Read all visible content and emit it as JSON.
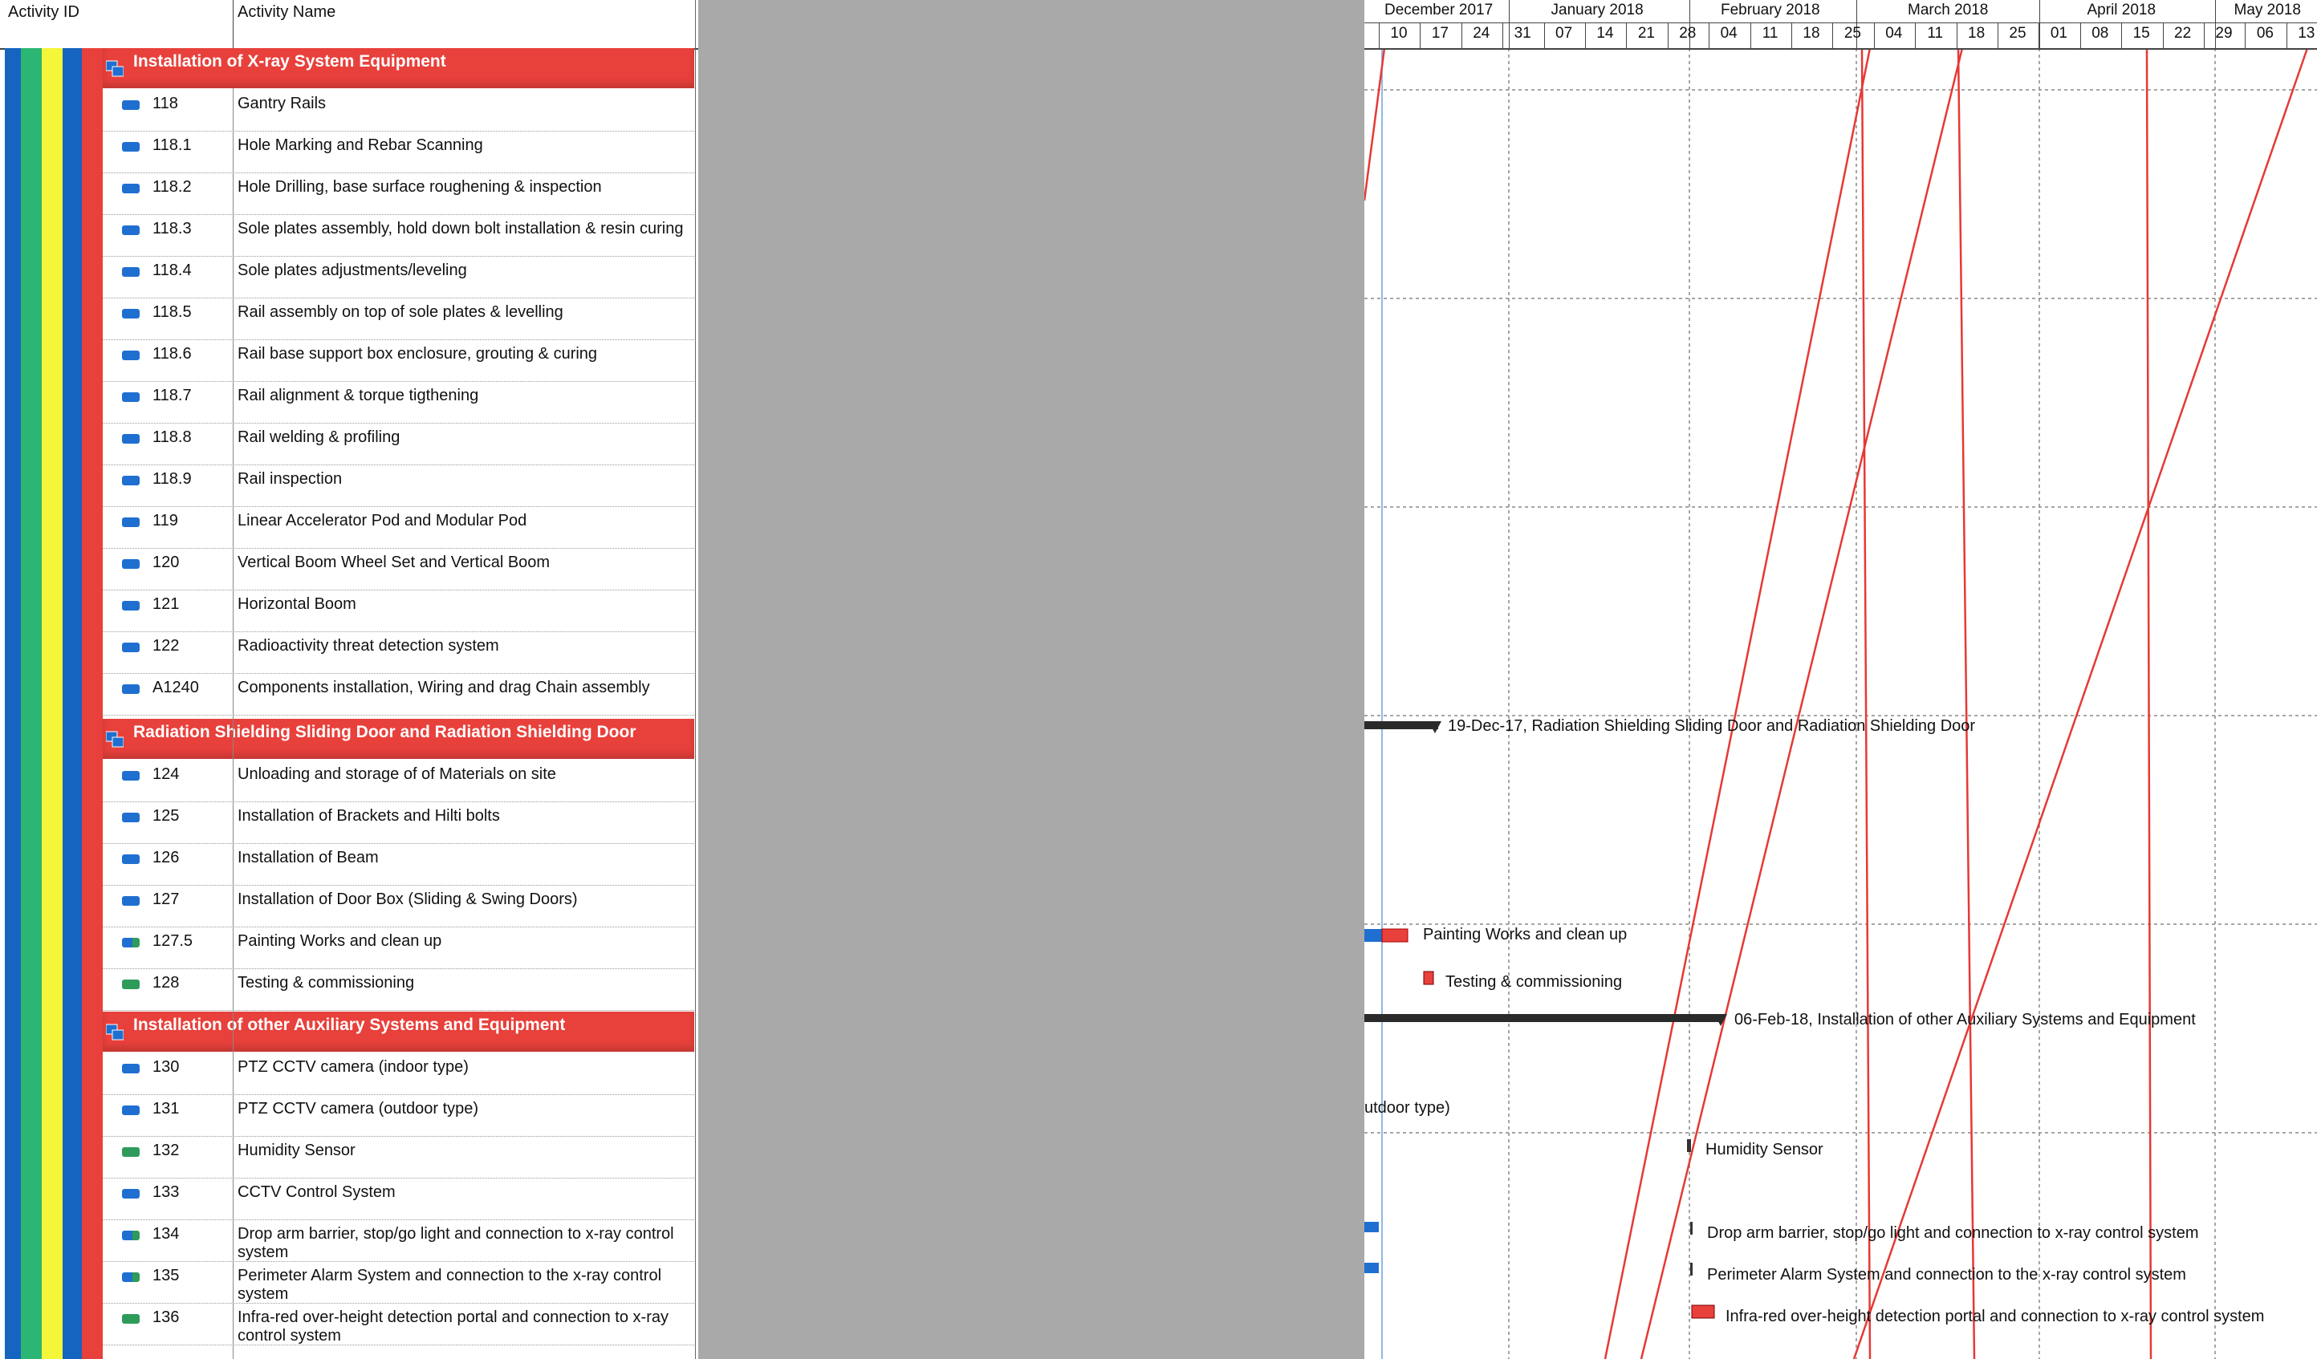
{
  "columns": {
    "activity_id": "Activity ID",
    "activity_name": "Activity Name"
  },
  "colors": {
    "band": "#e8403b",
    "blue_icon": "#1f6fd1",
    "green_icon": "#2e9b5a",
    "stripe_blue": "#1565c0",
    "stripe_green": "#2bb673",
    "stripe_yellow": "#f5f53a",
    "gray_panel": "#a9a9a9",
    "critical_line": "#e53935"
  },
  "groups": [
    {
      "title": "Installation of X-ray System Equipment"
    },
    {
      "title": "Radiation Shielding Sliding Door and Radiation Shielding Door"
    },
    {
      "title": "Installation of other Auxiliary Systems and Equipment"
    }
  ],
  "rows": [
    {
      "id": "118",
      "name": "Gantry Rails",
      "icon": "blue"
    },
    {
      "id": "118.1",
      "name": "Hole Marking and Rebar Scanning",
      "icon": "blue"
    },
    {
      "id": "118.2",
      "name": "Hole Drilling, base surface roughening & inspection",
      "icon": "blue"
    },
    {
      "id": "118.3",
      "name": "Sole plates assembly, hold down bolt installation & resin curing",
      "icon": "blue"
    },
    {
      "id": "118.4",
      "name": "Sole plates adjustments/leveling",
      "icon": "blue"
    },
    {
      "id": "118.5",
      "name": "Rail assembly on top of sole plates & levelling",
      "icon": "blue"
    },
    {
      "id": "118.6",
      "name": "Rail base support box enclosure, grouting & curing",
      "icon": "blue"
    },
    {
      "id": "118.7",
      "name": "Rail alignment & torque tigthening",
      "icon": "blue"
    },
    {
      "id": "118.8",
      "name": "Rail welding & profiling",
      "icon": "blue"
    },
    {
      "id": "118.9",
      "name": "Rail inspection",
      "icon": "blue"
    },
    {
      "id": "119",
      "name": "Linear Accelerator Pod and Modular Pod",
      "icon": "blue"
    },
    {
      "id": "120",
      "name": "Vertical Boom Wheel Set and Vertical Boom",
      "icon": "blue"
    },
    {
      "id": "121",
      "name": "Horizontal Boom",
      "icon": "blue"
    },
    {
      "id": "122",
      "name": "Radioactivity threat detection system",
      "icon": "blue"
    },
    {
      "id": "A1240",
      "name": "Components installation, Wiring and drag Chain assembly",
      "icon": "blue"
    },
    {
      "id": "124",
      "name": "Unloading and storage of of Materials on site",
      "icon": "blue"
    },
    {
      "id": "125",
      "name": "Installation of Brackets and Hilti bolts",
      "icon": "blue"
    },
    {
      "id": "126",
      "name": "Installation of Beam",
      "icon": "blue"
    },
    {
      "id": "127",
      "name": "Installation of Door Box (Sliding & Swing Doors)",
      "icon": "blue"
    },
    {
      "id": "127.5",
      "name": "Painting Works and clean up",
      "icon": "blue-green"
    },
    {
      "id": "128",
      "name": "Testing & commissioning",
      "icon": "green"
    },
    {
      "id": "130",
      "name": "PTZ CCTV camera (indoor type)",
      "icon": "blue"
    },
    {
      "id": "131",
      "name": "PTZ CCTV camera (outdoor type)",
      "icon": "blue"
    },
    {
      "id": "132",
      "name": "Humidity Sensor",
      "icon": "green"
    },
    {
      "id": "133",
      "name": "CCTV Control System",
      "icon": "blue"
    },
    {
      "id": "134",
      "name": "Drop arm barrier, stop/go light and connection to x-ray control system",
      "icon": "blue-green"
    },
    {
      "id": "135",
      "name": "Perimeter Alarm System and connection to the x-ray control system",
      "icon": "blue-green"
    },
    {
      "id": "136",
      "name": "Infra-red over-height detection portal and connection to x-ray control system",
      "icon": "green"
    }
  ],
  "timescale": {
    "months": [
      "December 2017",
      "January 2018",
      "February 2018",
      "March 2018",
      "April 2018",
      "May 2018"
    ],
    "weeks": [
      "10",
      "17",
      "24",
      "31",
      "07",
      "14",
      "21",
      "28",
      "04",
      "11",
      "18",
      "25",
      "04",
      "11",
      "18",
      "25",
      "01",
      "08",
      "15",
      "22",
      "29",
      "06",
      "13"
    ]
  },
  "gantt_labels": {
    "radiation_summary": "19-Dec-17, Radiation Shielding Sliding Door and Radiation Shielding Door",
    "painting": "Painting Works and clean up",
    "testing": "Testing & commissioning",
    "auxiliary_summary": "06-Feb-18, Installation of other Auxiliary Systems and Equipment",
    "cctv_outdoor": "utdoor type)",
    "humidity": "Humidity Sensor",
    "drop_arm": "Drop arm barrier, stop/go light and connection to x-ray control system",
    "perimeter": "Perimeter Alarm System and connection to the x-ray control system",
    "infrared": "Infra-red over-height detection portal and connection to x-ray control system"
  }
}
